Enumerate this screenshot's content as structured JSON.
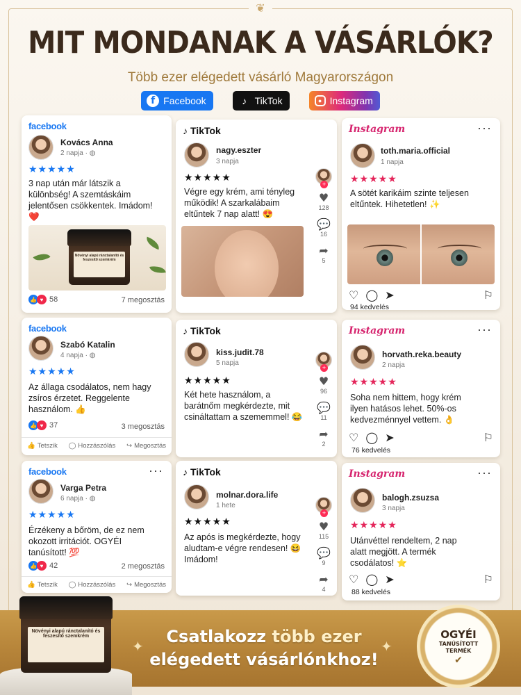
{
  "header": {
    "title": "MIT MONDANAK A VÁSÁRLÓK?",
    "subtitle": "Több ezer elégedett vásárló Magyarországon"
  },
  "platform_badges": [
    {
      "label": "Facebook",
      "icon": "facebook-icon",
      "color": "#1877f2"
    },
    {
      "label": "TikTok",
      "icon": "tiktok-icon",
      "color": "#111111"
    },
    {
      "label": "Instagram",
      "icon": "instagram-icon",
      "color": "#dd2a7b"
    }
  ],
  "brands": {
    "facebook": "facebook",
    "tiktok": "TikTok",
    "instagram": "Instagram"
  },
  "stars": "★★★★★",
  "reviews": {
    "fb1": {
      "name": "Kovács Anna",
      "time": "2 napja · ◍",
      "text": "3 nap után már látszik a különbség! A szemtáskáim jelentősen csökkentek. Imádom! ❤️",
      "reactions": "58",
      "shares": "7 megosztás",
      "jar_label": "Növényi alapú ránctalanító és feszesítő szemkrém"
    },
    "fb2": {
      "name": "Szabó Katalin",
      "time": "4 napja · ◍",
      "text": "Az állaga csodálatos, nem hagy zsíros érzetet. Reggelente használom. 👍",
      "reactions": "37",
      "shares": "3 megosztás"
    },
    "fb3": {
      "name": "Varga Petra",
      "time": "6 napja · ◍",
      "text": "Érzékeny a bőröm, de ez nem okozott irritációt. OGYÉI tanúsított! 💯",
      "reactions": "42",
      "shares": "2 megosztás"
    },
    "tt1": {
      "name": "nagy.eszter",
      "time": "3 napja",
      "text": "Végre egy krém, ami tényleg működik! A szarkalábaim eltűntek 7 nap alatt! 😍",
      "likes": "128",
      "comments": "16",
      "shares": "5"
    },
    "tt2": {
      "name": "kiss.judit.78",
      "time": "5 napja",
      "text": "Két hete használom, a barátnőm megkérdezte, mit csináltattam a szememmel! 😂",
      "likes": "96",
      "comments": "11",
      "shares": "2"
    },
    "tt3": {
      "name": "molnar.dora.life",
      "time": "1 hete",
      "text": "Az após is megkérdezte, hogy aludtam-e végre rendesen! 😆 Imádom!",
      "likes": "115",
      "comments": "9",
      "shares": "4"
    },
    "ig1": {
      "name": "toth.maria.official",
      "time": "1 napja",
      "text": "A sötét karikáim szinte teljesen eltűntek. Hihetetlen! ✨",
      "likes": "94 kedvelés"
    },
    "ig2": {
      "name": "horvath.reka.beauty",
      "time": "2 napja",
      "text": "Soha nem hittem, hogy krém ilyen hatásos lehet. 50%-os kedvezménnyel vettem. 👌",
      "likes": "76 kedvelés"
    },
    "ig3": {
      "name": "balogh.zsuzsa",
      "time": "3 napja",
      "text": "Utánvéttel rendeltem, 2 nap alatt megjött. A termék csodálatos! ⭐",
      "likes": "88 kedvelés"
    }
  },
  "fb_actions": {
    "like": "Tetszik",
    "comment": "Hozzászólás",
    "share": "Megosztás"
  },
  "banner": {
    "line1_a": "Csatlakozz ",
    "line1_b": "több ezer",
    "line2": "elégedett vásárlónkhoz!",
    "product_label": "Növényi alapú ránctalanító és feszesítő szemkrém"
  },
  "seal": {
    "line1": "OGYÉI",
    "line2": "TANÚSÍTOTT",
    "line3": "TERMÉK"
  },
  "colors": {
    "facebook": "#1877f2",
    "instagram": "#d6246e",
    "stars_pink": "#e4255a",
    "banner_gold": "#b7853a"
  }
}
